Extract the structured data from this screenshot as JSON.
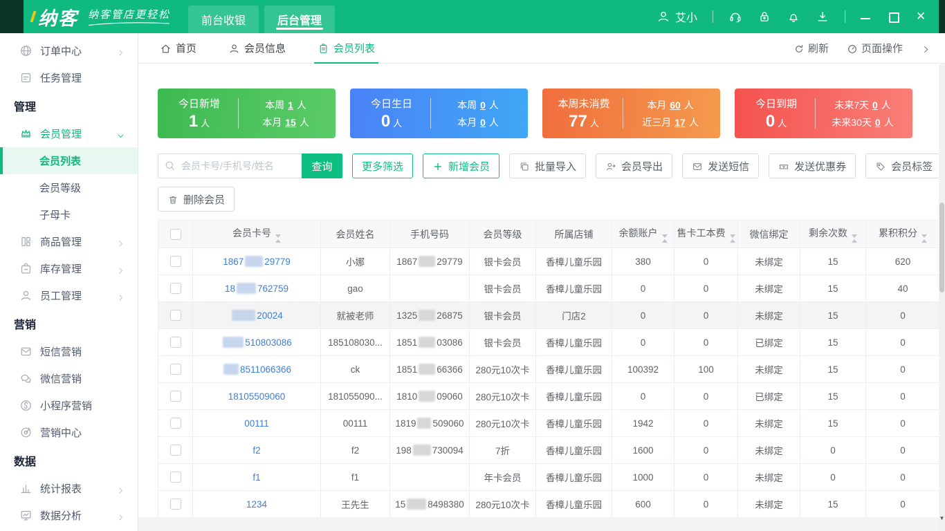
{
  "topbar": {
    "brand": "纳客",
    "tagline": "纳客管店更轻松",
    "nav_tabs": [
      {
        "name": "front-cashier",
        "label": "前台收银",
        "active": false
      },
      {
        "name": "backend-manage",
        "label": "后台管理",
        "active": true
      }
    ],
    "user": "艾小",
    "tool_icons": [
      {
        "name": "headset"
      },
      {
        "name": "lock"
      },
      {
        "name": "bell"
      },
      {
        "name": "download"
      }
    ],
    "window_controls": [
      {
        "name": "minimize"
      },
      {
        "name": "maximize"
      },
      {
        "name": "close"
      }
    ]
  },
  "sidebar": {
    "items": [
      {
        "type": "item",
        "name": "order-center",
        "icon": "globe",
        "label": "订单中心",
        "arrow": "right"
      },
      {
        "type": "item",
        "name": "task-manage",
        "icon": "tasks",
        "label": "任务管理"
      },
      {
        "type": "section",
        "name": "manage",
        "label": "管理"
      },
      {
        "type": "item",
        "name": "member-manage",
        "icon": "crown",
        "label": "会员管理",
        "arrow": "down",
        "green": true
      },
      {
        "type": "sub",
        "name": "member-list",
        "label": "会员列表",
        "active": true
      },
      {
        "type": "sub",
        "name": "member-level",
        "label": "会员等级"
      },
      {
        "type": "sub",
        "name": "parent-child-card",
        "label": "子母卡"
      },
      {
        "type": "item",
        "name": "goods-manage",
        "icon": "goods",
        "label": "商品管理",
        "arrow": "right"
      },
      {
        "type": "item",
        "name": "stock-manage",
        "icon": "stock",
        "label": "库存管理",
        "arrow": "right"
      },
      {
        "type": "item",
        "name": "staff-manage",
        "icon": "staff",
        "label": "员工管理",
        "arrow": "right"
      },
      {
        "type": "section",
        "name": "marketing",
        "label": "营销"
      },
      {
        "type": "item",
        "name": "sms-marketing",
        "icon": "sms",
        "label": "短信营销"
      },
      {
        "type": "item",
        "name": "wechat-marketing",
        "icon": "wechat",
        "label": "微信营销"
      },
      {
        "type": "item",
        "name": "miniapp-marketing",
        "icon": "miniapp",
        "label": "小程序营销"
      },
      {
        "type": "item",
        "name": "marketing-center",
        "icon": "target",
        "label": "营销中心"
      },
      {
        "type": "section",
        "name": "data",
        "label": "数据"
      },
      {
        "type": "item",
        "name": "statistics-report",
        "icon": "report",
        "label": "统计报表",
        "arrow": "right"
      },
      {
        "type": "item",
        "name": "data-analysis",
        "icon": "analysis",
        "label": "数据分析",
        "arrow": "right"
      }
    ]
  },
  "tabstrip": {
    "tabs": [
      {
        "name": "home",
        "icon": "home",
        "label": "首页",
        "active": false
      },
      {
        "name": "member-info",
        "icon": "user",
        "label": "会员信息",
        "active": false
      },
      {
        "name": "member-list",
        "icon": "clipboard",
        "label": "会员列表",
        "active": true
      }
    ],
    "refresh_label": "刷新",
    "page_actions_label": "页面操作"
  },
  "stats": [
    {
      "name": "today-new",
      "title": "今日新增",
      "value": "1",
      "unit": "人",
      "gradient": [
        "#3eba52",
        "#5bcb68"
      ],
      "rows": [
        {
          "label": "本周",
          "value": "1",
          "unit": "人"
        },
        {
          "label": "本月",
          "value": "15",
          "unit": "人"
        }
      ]
    },
    {
      "name": "today-birthday",
      "title": "今日生日",
      "value": "0",
      "unit": "人",
      "gradient": [
        "#4b82f7",
        "#3fa7f5"
      ],
      "rows": [
        {
          "label": "本周",
          "value": "0",
          "unit": "人"
        },
        {
          "label": "本月",
          "value": "0",
          "unit": "人"
        }
      ]
    },
    {
      "name": "week-no-consume",
      "title": "本周未消费",
      "value": "77",
      "unit": "人",
      "gradient": [
        "#f06e3d",
        "#f59a4d"
      ],
      "rows": [
        {
          "label": "本月",
          "value": "60",
          "unit": "人"
        },
        {
          "label": "近三月",
          "value": "17",
          "unit": "人"
        }
      ]
    },
    {
      "name": "today-expire",
      "title": "今日到期",
      "value": "0",
      "unit": "人",
      "gradient": [
        "#f4524e",
        "#f97f78"
      ],
      "rows": [
        {
          "label": "未来7天",
          "value": "0",
          "unit": "人"
        },
        {
          "label": "未来30天",
          "value": "0",
          "unit": "人"
        }
      ]
    }
  ],
  "toolbar": {
    "search_placeholder": "会员卡号/手机号/姓名",
    "search_button": "查询",
    "buttons": [
      {
        "name": "more-filters",
        "label": "更多筛选",
        "style": "green"
      },
      {
        "name": "add-member",
        "label": "新增会员",
        "style": "green",
        "icon": "plus"
      },
      {
        "name": "batch-import",
        "label": "批量导入",
        "style": "default",
        "icon": "import"
      },
      {
        "name": "member-export",
        "label": "会员导出",
        "style": "default",
        "icon": "export"
      },
      {
        "name": "send-sms",
        "label": "发送短信",
        "style": "default",
        "icon": "sms"
      },
      {
        "name": "send-coupon",
        "label": "发送优惠券",
        "style": "default",
        "icon": "coupon"
      },
      {
        "name": "member-tag",
        "label": "会员标签",
        "style": "default",
        "icon": "tag"
      }
    ],
    "delete_button": {
      "name": "delete-member",
      "label": "删除会员",
      "icon": "trash"
    }
  },
  "table": {
    "columns": [
      {
        "key": "card",
        "label": "会员卡号",
        "sortable": true
      },
      {
        "key": "name",
        "label": "会员姓名",
        "sortable": false
      },
      {
        "key": "phone",
        "label": "手机号码",
        "sortable": false
      },
      {
        "key": "level",
        "label": "会员等级",
        "sortable": false
      },
      {
        "key": "store",
        "label": "所属店铺",
        "sortable": false
      },
      {
        "key": "balance",
        "label": "余额账户",
        "sortable": true
      },
      {
        "key": "fee",
        "label": "售卡工本费",
        "sortable": true
      },
      {
        "key": "wechat",
        "label": "微信绑定",
        "sortable": false
      },
      {
        "key": "times",
        "label": "剩余次数",
        "sortable": true
      },
      {
        "key": "points",
        "label": "累积积分",
        "sortable": true
      }
    ],
    "rows": [
      {
        "card": [
          {
            "t": "1867"
          },
          {
            "r": 26
          },
          {
            "t": "29779"
          }
        ],
        "name": "小娜",
        "phone": [
          {
            "t": "1867"
          },
          {
            "r": 24
          },
          {
            "t": "29779"
          }
        ],
        "level": "银卡会员",
        "store": "香樟儿童乐园",
        "balance": "380",
        "fee": "0",
        "wechat": "未绑定",
        "times": "15",
        "points": "620",
        "hl": false
      },
      {
        "card": [
          {
            "t": "18"
          },
          {
            "r": 28
          },
          {
            "t": "762759"
          }
        ],
        "name": "gao",
        "phone": [],
        "level": "银卡会员",
        "store": "香樟儿童乐园",
        "balance": "0",
        "fee": "0",
        "wechat": "未绑定",
        "times": "15",
        "points": "40",
        "hl": false
      },
      {
        "card": [
          {
            "r": 34
          },
          {
            "t": "20024"
          }
        ],
        "name": "就被老师",
        "phone": [
          {
            "t": "1325"
          },
          {
            "r": 24
          },
          {
            "t": "26875"
          }
        ],
        "level": "银卡会员",
        "store": "门店2",
        "balance": "0",
        "fee": "0",
        "wechat": "未绑定",
        "times": "15",
        "points": "0",
        "hl": true
      },
      {
        "card": [
          {
            "r": 30
          },
          {
            "t": "510803086"
          }
        ],
        "name": "185108030...",
        "phone": [
          {
            "t": "1851"
          },
          {
            "r": 24
          },
          {
            "t": "03086"
          }
        ],
        "level": "银卡会员",
        "store": "香樟儿童乐园",
        "balance": "0",
        "fee": "0",
        "wechat": "已绑定",
        "times": "15",
        "points": "0",
        "hl": false
      },
      {
        "card": [
          {
            "r": 22
          },
          {
            "t": "8511066366"
          }
        ],
        "name": "ck",
        "phone": [
          {
            "t": "1851"
          },
          {
            "r": 24
          },
          {
            "t": "66366"
          }
        ],
        "level": "280元10次卡",
        "store": "香樟儿童乐园",
        "balance": "100392",
        "fee": "100",
        "wechat": "未绑定",
        "times": "15",
        "points": "0",
        "hl": false
      },
      {
        "card": [
          {
            "t": "18105509060"
          }
        ],
        "name": "181055090...",
        "phone": [
          {
            "t": "1810"
          },
          {
            "r": 24
          },
          {
            "t": "09060"
          }
        ],
        "level": "280元10次卡",
        "store": "香樟儿童乐园",
        "balance": "0",
        "fee": "0",
        "wechat": "已绑定",
        "times": "15",
        "points": "0",
        "hl": false
      },
      {
        "card": [
          {
            "t": "00111"
          }
        ],
        "name": "00111",
        "phone": [
          {
            "t": "1819"
          },
          {
            "r": 20
          },
          {
            "t": "509060"
          }
        ],
        "level": "280元10次卡",
        "store": "香樟儿童乐园",
        "balance": "1942",
        "fee": "0",
        "wechat": "未绑定",
        "times": "15",
        "points": "0",
        "hl": false
      },
      {
        "card": [
          {
            "t": "f2"
          }
        ],
        "name": "f2",
        "phone": [
          {
            "t": "198"
          },
          {
            "r": 26
          },
          {
            "t": "730094"
          }
        ],
        "level": "7折",
        "store": "香樟儿童乐园",
        "balance": "1600",
        "fee": "0",
        "wechat": "未绑定",
        "times": "0",
        "points": "0",
        "hl": false
      },
      {
        "card": [
          {
            "t": "f1"
          }
        ],
        "name": "f1",
        "phone": [],
        "level": "年卡会员",
        "store": "香樟儿童乐园",
        "balance": "1000",
        "fee": "0",
        "wechat": "未绑定",
        "times": "0",
        "points": "0",
        "hl": false
      },
      {
        "card": [
          {
            "t": "1234"
          }
        ],
        "name": "王先生",
        "phone": [
          {
            "t": "15"
          },
          {
            "r": 28
          },
          {
            "t": "8498380"
          }
        ],
        "level": "280元10次卡",
        "store": "香樟儿童乐园",
        "balance": "600",
        "fee": "0",
        "wechat": "未绑定",
        "times": "15",
        "points": "0",
        "hl": false
      }
    ]
  }
}
